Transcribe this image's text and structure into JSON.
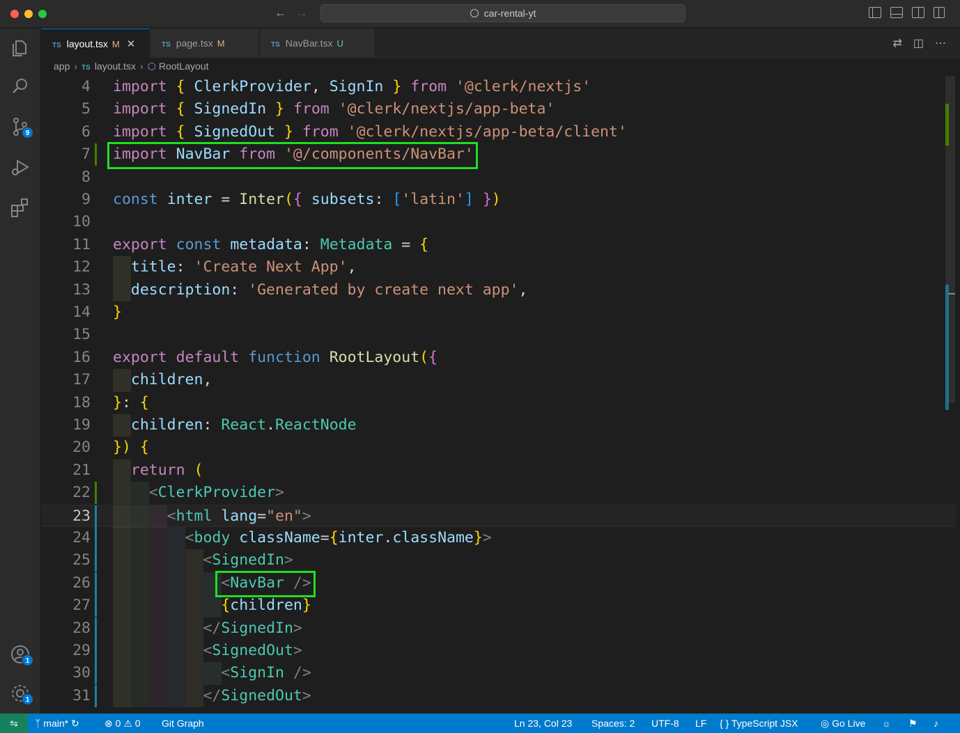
{
  "window": {
    "title": "car-rental-yt"
  },
  "activity_bar": {
    "source_control_badge": "9",
    "accounts_badge": "1",
    "settings_badge": "1"
  },
  "tabs": [
    {
      "lang": "TS",
      "label": "layout.tsx",
      "status": "M",
      "active": true
    },
    {
      "lang": "TS",
      "label": "page.tsx",
      "status": "M",
      "active": false
    },
    {
      "lang": "TS",
      "label": "NavBar.tsx",
      "status": "U",
      "active": false
    }
  ],
  "breadcrumb": {
    "folder": "app",
    "file_lang": "TS",
    "file": "layout.tsx",
    "symbol": "RootLayout"
  },
  "editor": {
    "current_line": 23,
    "highlighted_lines": [
      7,
      26
    ],
    "lines": [
      {
        "n": "4",
        "text": "import { ClerkProvider, SignIn } from '@clerk/nextjs'"
      },
      {
        "n": "5",
        "text": "import { SignedIn } from '@clerk/nextjs/app-beta'"
      },
      {
        "n": "6",
        "text": "import { SignedOut } from '@clerk/nextjs/app-beta/client'"
      },
      {
        "n": "7",
        "text": "import NavBar from '@/components/NavBar'"
      },
      {
        "n": "8",
        "text": ""
      },
      {
        "n": "9",
        "text": "const inter = Inter({ subsets: ['latin'] })"
      },
      {
        "n": "10",
        "text": ""
      },
      {
        "n": "11",
        "text": "export const metadata: Metadata = {"
      },
      {
        "n": "12",
        "text": "  title: 'Create Next App',"
      },
      {
        "n": "13",
        "text": "  description: 'Generated by create next app',"
      },
      {
        "n": "14",
        "text": "}"
      },
      {
        "n": "15",
        "text": ""
      },
      {
        "n": "16",
        "text": "export default function RootLayout({"
      },
      {
        "n": "17",
        "text": "  children,"
      },
      {
        "n": "18",
        "text": "}: {"
      },
      {
        "n": "19",
        "text": "  children: React.ReactNode"
      },
      {
        "n": "20",
        "text": "}) {"
      },
      {
        "n": "21",
        "text": "  return ("
      },
      {
        "n": "22",
        "text": "    <ClerkProvider>"
      },
      {
        "n": "23",
        "text": "      <html lang=\"en\">"
      },
      {
        "n": "24",
        "text": "        <body className={inter.className}>"
      },
      {
        "n": "25",
        "text": "          <SignedIn>"
      },
      {
        "n": "26",
        "text": "            <NavBar />"
      },
      {
        "n": "27",
        "text": "            {children}"
      },
      {
        "n": "28",
        "text": "          </SignedIn>"
      },
      {
        "n": "29",
        "text": "          <SignedOut>"
      },
      {
        "n": "30",
        "text": "            <SignIn />"
      },
      {
        "n": "31",
        "text": "          </SignedOut>"
      }
    ]
  },
  "status_bar": {
    "branch": "main*",
    "errors": "0",
    "warnings": "0",
    "git_graph": "Git Graph",
    "cursor": "Ln 23, Col 23",
    "indent": "Spaces: 2",
    "encoding": "UTF-8",
    "eol": "LF",
    "language": "TypeScript JSX",
    "go_live": "Go Live"
  },
  "colors": {
    "accent": "#007acc",
    "highlight_box": "#22dd22",
    "modified": "#d7ba7d",
    "untracked": "#73c991"
  }
}
